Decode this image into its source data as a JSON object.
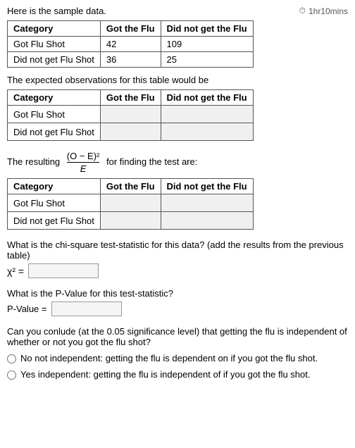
{
  "header": {
    "intro_text": "Here is the sample data.",
    "timer": "1hr10mins"
  },
  "table1": {
    "headers": [
      "Category",
      "Got the Flu",
      "Did not get the Flu"
    ],
    "rows": [
      {
        "label": "Got Flu Shot",
        "col1": "42",
        "col2": "109"
      },
      {
        "label": "Did not get Flu Shot",
        "col1": "36",
        "col2": "25"
      }
    ]
  },
  "section2": {
    "text": "The expected observations for this table would be"
  },
  "table2": {
    "headers": [
      "Category",
      "Got the Flu",
      "Did not get the Flu"
    ],
    "rows": [
      {
        "label": "Got Flu Shot"
      },
      {
        "label": "Did not get Flu Shot"
      }
    ]
  },
  "section3": {
    "text_before": "The resulting",
    "formula_numerator": "(O − E)²",
    "formula_denominator": "E",
    "text_after": "for finding the test are:"
  },
  "table3": {
    "headers": [
      "Category",
      "Got the Flu",
      "Did not get the Flu"
    ],
    "rows": [
      {
        "label": "Got Flu Shot"
      },
      {
        "label": "Did not get Flu Shot"
      }
    ]
  },
  "chi_section": {
    "question": "What is the chi-square test-statistic for this data? (add the results from the previous table)",
    "label": "χ² =",
    "placeholder": ""
  },
  "pval_section": {
    "question": "What is the P-Value for this test-statistic?",
    "label": "P-Value =",
    "placeholder": ""
  },
  "conclusion_section": {
    "question": "Can you conlude (at the 0.05 significance level) that getting the flu is independent of whether or not you got the flu shot?",
    "options": [
      "No not independent: getting the flu is dependent on if you got the flu shot.",
      "Yes independent: getting the flu is independent of if you got the flu shot."
    ]
  }
}
